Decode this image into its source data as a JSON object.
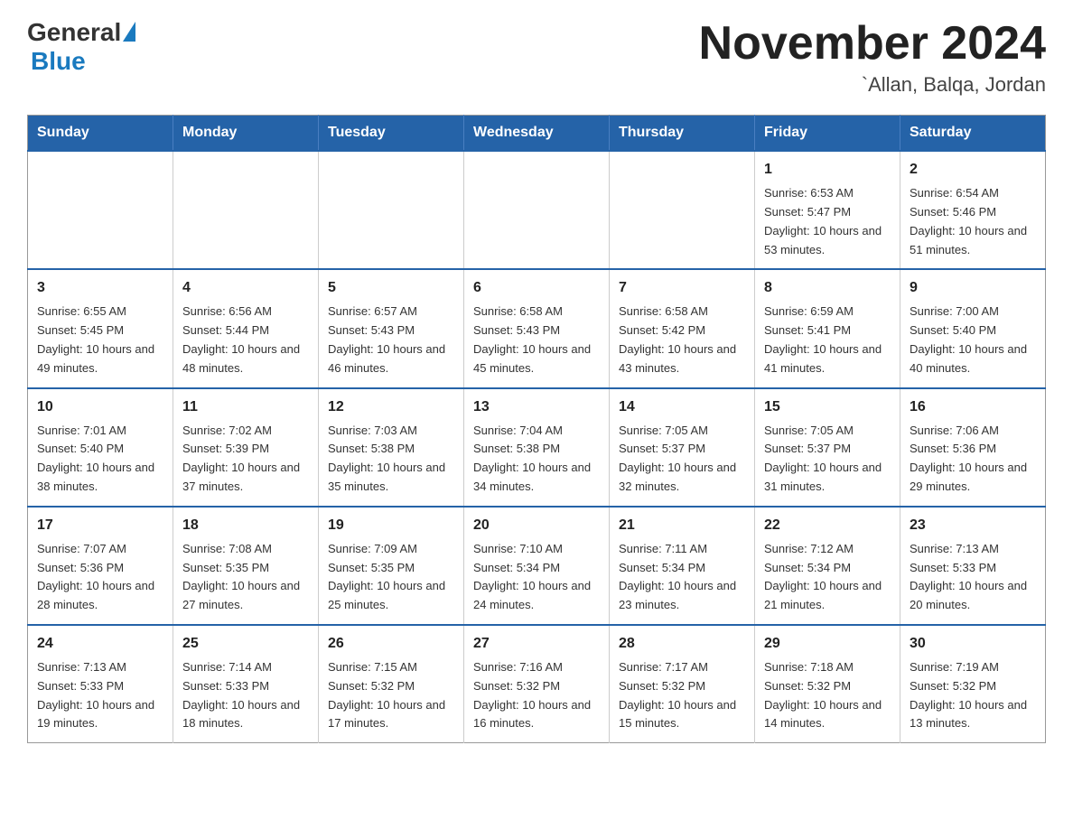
{
  "header": {
    "logo_general": "General",
    "logo_blue": "Blue",
    "month_title": "November 2024",
    "location": "`Allan, Balqa, Jordan"
  },
  "days_of_week": [
    "Sunday",
    "Monday",
    "Tuesday",
    "Wednesday",
    "Thursday",
    "Friday",
    "Saturday"
  ],
  "weeks": [
    [
      {
        "day": "",
        "sunrise": "",
        "sunset": "",
        "daylight": ""
      },
      {
        "day": "",
        "sunrise": "",
        "sunset": "",
        "daylight": ""
      },
      {
        "day": "",
        "sunrise": "",
        "sunset": "",
        "daylight": ""
      },
      {
        "day": "",
        "sunrise": "",
        "sunset": "",
        "daylight": ""
      },
      {
        "day": "",
        "sunrise": "",
        "sunset": "",
        "daylight": ""
      },
      {
        "day": "1",
        "sunrise": "Sunrise: 6:53 AM",
        "sunset": "Sunset: 5:47 PM",
        "daylight": "Daylight: 10 hours and 53 minutes."
      },
      {
        "day": "2",
        "sunrise": "Sunrise: 6:54 AM",
        "sunset": "Sunset: 5:46 PM",
        "daylight": "Daylight: 10 hours and 51 minutes."
      }
    ],
    [
      {
        "day": "3",
        "sunrise": "Sunrise: 6:55 AM",
        "sunset": "Sunset: 5:45 PM",
        "daylight": "Daylight: 10 hours and 49 minutes."
      },
      {
        "day": "4",
        "sunrise": "Sunrise: 6:56 AM",
        "sunset": "Sunset: 5:44 PM",
        "daylight": "Daylight: 10 hours and 48 minutes."
      },
      {
        "day": "5",
        "sunrise": "Sunrise: 6:57 AM",
        "sunset": "Sunset: 5:43 PM",
        "daylight": "Daylight: 10 hours and 46 minutes."
      },
      {
        "day": "6",
        "sunrise": "Sunrise: 6:58 AM",
        "sunset": "Sunset: 5:43 PM",
        "daylight": "Daylight: 10 hours and 45 minutes."
      },
      {
        "day": "7",
        "sunrise": "Sunrise: 6:58 AM",
        "sunset": "Sunset: 5:42 PM",
        "daylight": "Daylight: 10 hours and 43 minutes."
      },
      {
        "day": "8",
        "sunrise": "Sunrise: 6:59 AM",
        "sunset": "Sunset: 5:41 PM",
        "daylight": "Daylight: 10 hours and 41 minutes."
      },
      {
        "day": "9",
        "sunrise": "Sunrise: 7:00 AM",
        "sunset": "Sunset: 5:40 PM",
        "daylight": "Daylight: 10 hours and 40 minutes."
      }
    ],
    [
      {
        "day": "10",
        "sunrise": "Sunrise: 7:01 AM",
        "sunset": "Sunset: 5:40 PM",
        "daylight": "Daylight: 10 hours and 38 minutes."
      },
      {
        "day": "11",
        "sunrise": "Sunrise: 7:02 AM",
        "sunset": "Sunset: 5:39 PM",
        "daylight": "Daylight: 10 hours and 37 minutes."
      },
      {
        "day": "12",
        "sunrise": "Sunrise: 7:03 AM",
        "sunset": "Sunset: 5:38 PM",
        "daylight": "Daylight: 10 hours and 35 minutes."
      },
      {
        "day": "13",
        "sunrise": "Sunrise: 7:04 AM",
        "sunset": "Sunset: 5:38 PM",
        "daylight": "Daylight: 10 hours and 34 minutes."
      },
      {
        "day": "14",
        "sunrise": "Sunrise: 7:05 AM",
        "sunset": "Sunset: 5:37 PM",
        "daylight": "Daylight: 10 hours and 32 minutes."
      },
      {
        "day": "15",
        "sunrise": "Sunrise: 7:05 AM",
        "sunset": "Sunset: 5:37 PM",
        "daylight": "Daylight: 10 hours and 31 minutes."
      },
      {
        "day": "16",
        "sunrise": "Sunrise: 7:06 AM",
        "sunset": "Sunset: 5:36 PM",
        "daylight": "Daylight: 10 hours and 29 minutes."
      }
    ],
    [
      {
        "day": "17",
        "sunrise": "Sunrise: 7:07 AM",
        "sunset": "Sunset: 5:36 PM",
        "daylight": "Daylight: 10 hours and 28 minutes."
      },
      {
        "day": "18",
        "sunrise": "Sunrise: 7:08 AM",
        "sunset": "Sunset: 5:35 PM",
        "daylight": "Daylight: 10 hours and 27 minutes."
      },
      {
        "day": "19",
        "sunrise": "Sunrise: 7:09 AM",
        "sunset": "Sunset: 5:35 PM",
        "daylight": "Daylight: 10 hours and 25 minutes."
      },
      {
        "day": "20",
        "sunrise": "Sunrise: 7:10 AM",
        "sunset": "Sunset: 5:34 PM",
        "daylight": "Daylight: 10 hours and 24 minutes."
      },
      {
        "day": "21",
        "sunrise": "Sunrise: 7:11 AM",
        "sunset": "Sunset: 5:34 PM",
        "daylight": "Daylight: 10 hours and 23 minutes."
      },
      {
        "day": "22",
        "sunrise": "Sunrise: 7:12 AM",
        "sunset": "Sunset: 5:34 PM",
        "daylight": "Daylight: 10 hours and 21 minutes."
      },
      {
        "day": "23",
        "sunrise": "Sunrise: 7:13 AM",
        "sunset": "Sunset: 5:33 PM",
        "daylight": "Daylight: 10 hours and 20 minutes."
      }
    ],
    [
      {
        "day": "24",
        "sunrise": "Sunrise: 7:13 AM",
        "sunset": "Sunset: 5:33 PM",
        "daylight": "Daylight: 10 hours and 19 minutes."
      },
      {
        "day": "25",
        "sunrise": "Sunrise: 7:14 AM",
        "sunset": "Sunset: 5:33 PM",
        "daylight": "Daylight: 10 hours and 18 minutes."
      },
      {
        "day": "26",
        "sunrise": "Sunrise: 7:15 AM",
        "sunset": "Sunset: 5:32 PM",
        "daylight": "Daylight: 10 hours and 17 minutes."
      },
      {
        "day": "27",
        "sunrise": "Sunrise: 7:16 AM",
        "sunset": "Sunset: 5:32 PM",
        "daylight": "Daylight: 10 hours and 16 minutes."
      },
      {
        "day": "28",
        "sunrise": "Sunrise: 7:17 AM",
        "sunset": "Sunset: 5:32 PM",
        "daylight": "Daylight: 10 hours and 15 minutes."
      },
      {
        "day": "29",
        "sunrise": "Sunrise: 7:18 AM",
        "sunset": "Sunset: 5:32 PM",
        "daylight": "Daylight: 10 hours and 14 minutes."
      },
      {
        "day": "30",
        "sunrise": "Sunrise: 7:19 AM",
        "sunset": "Sunset: 5:32 PM",
        "daylight": "Daylight: 10 hours and 13 minutes."
      }
    ]
  ]
}
